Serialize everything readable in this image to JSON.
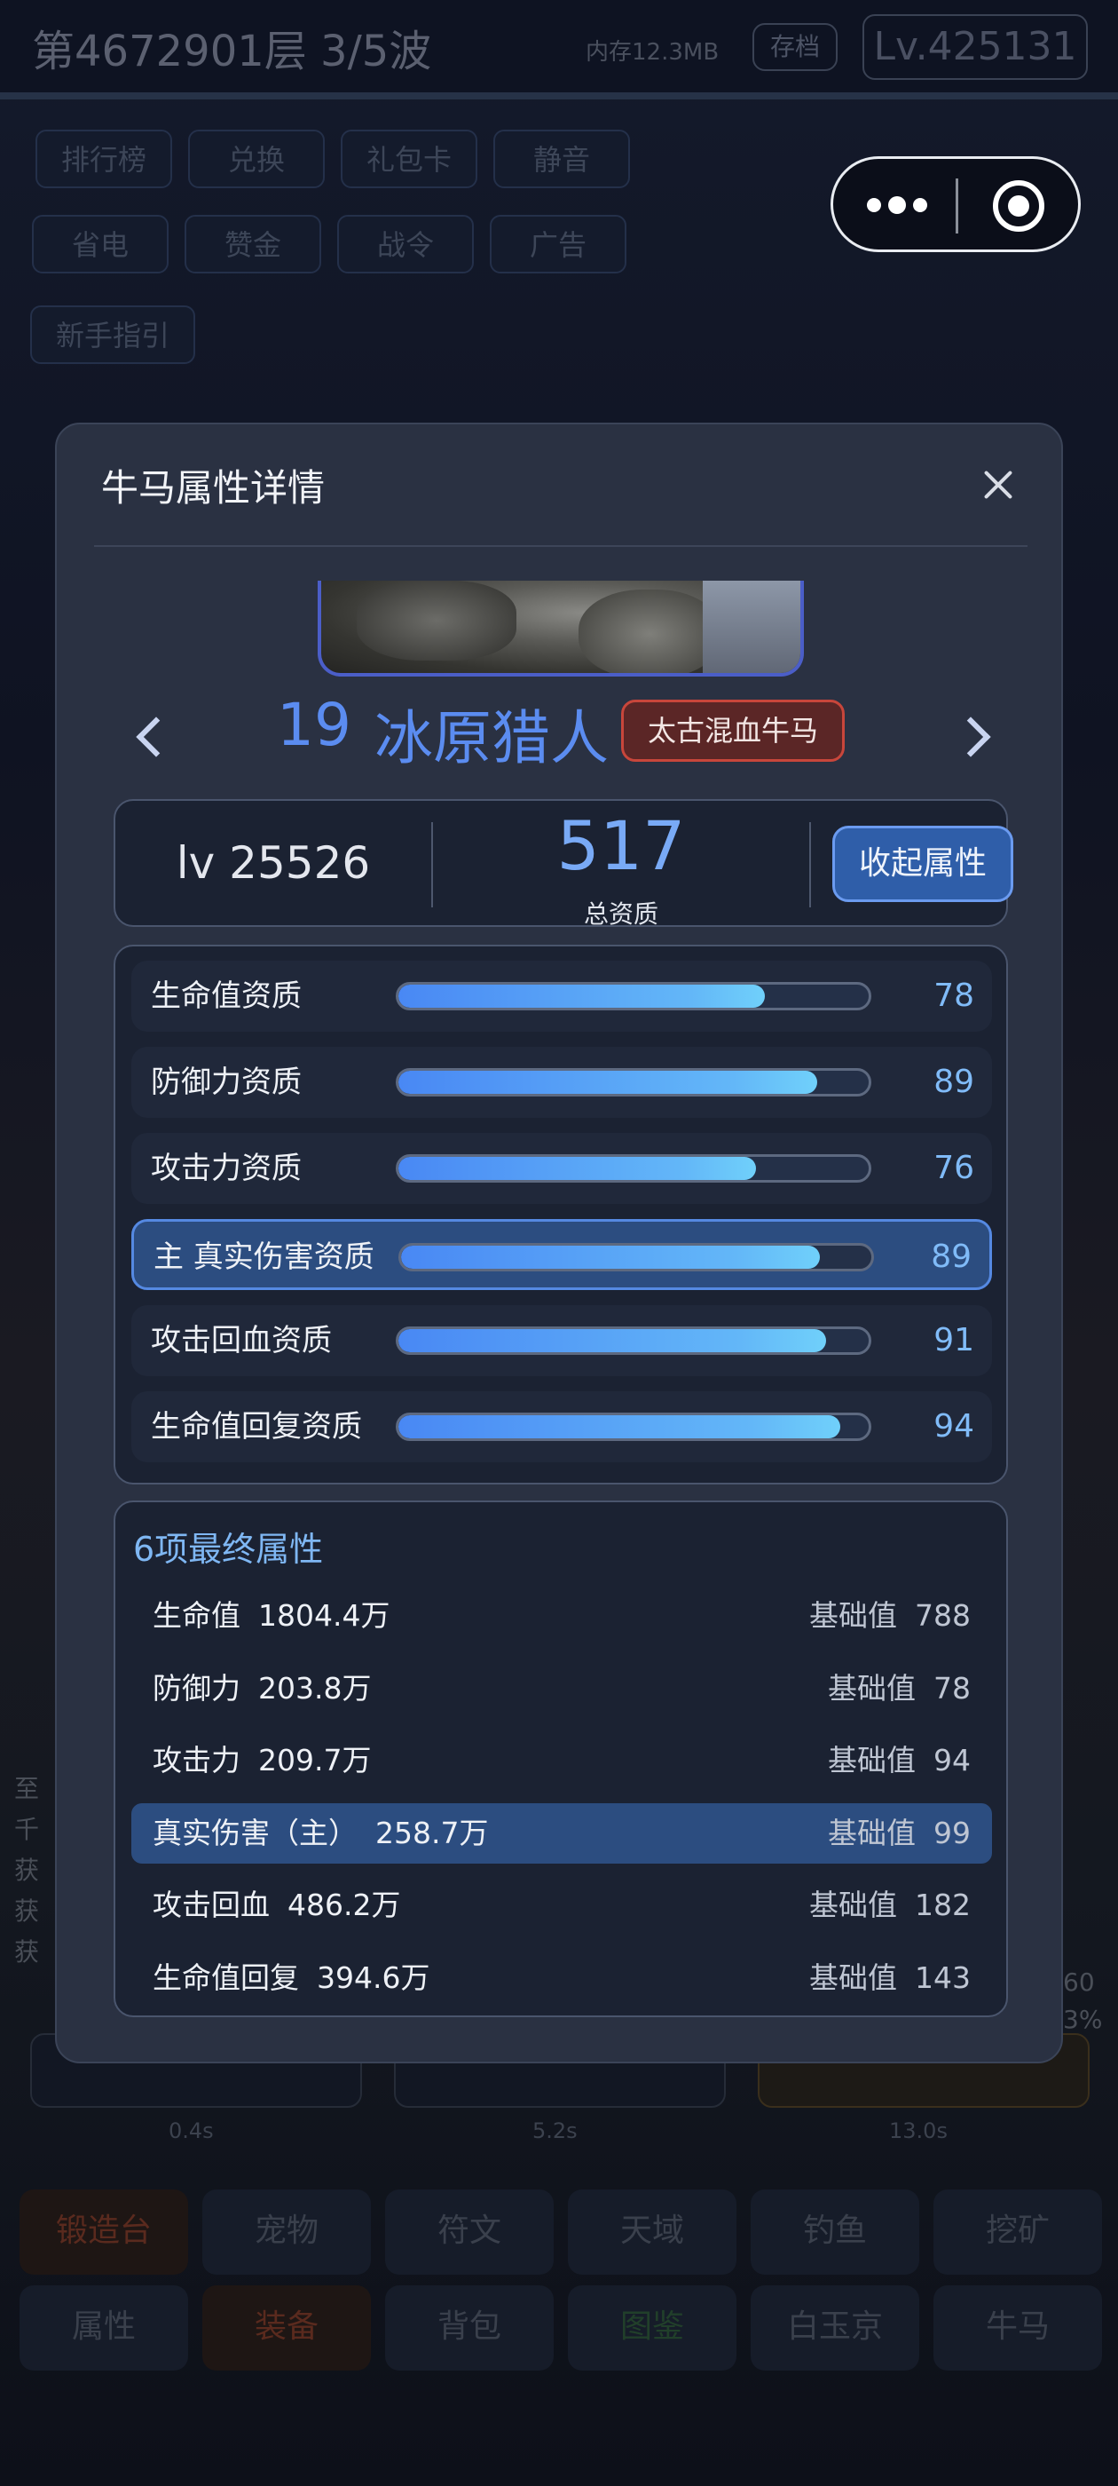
{
  "background": {
    "floor_text": "第4672901层  3/5波",
    "memory_text": "内存12.3MB",
    "save_label": "存档",
    "level_text": "Lv.425131",
    "buttons_row1": [
      "排行榜",
      "兑换",
      "礼包卡",
      "静音"
    ],
    "buttons_row2": [
      "省电",
      "赞金",
      "战令",
      "广告"
    ],
    "guide_button": "新手指引",
    "side_text": [
      "至",
      "千",
      "获",
      "获",
      "获"
    ],
    "side_right_text": [
      "60",
      "3%"
    ],
    "stat_labels": [
      "0.4s",
      "5.2s",
      "13.0s"
    ],
    "footer_row1": [
      "锻造台",
      "宠物",
      "符文",
      "天域",
      "钓鱼",
      "挖矿"
    ],
    "footer_row2": [
      "属性",
      "装备",
      "背包",
      "图鉴",
      "白玉京",
      "牛马"
    ]
  },
  "capsule": {
    "more_icon": "more-dots-icon",
    "close_icon": "target-circle-icon"
  },
  "modal": {
    "title": "牛马属性详情",
    "hero": {
      "id": "19",
      "name": "冰原猎人",
      "badge": "太古混血牛马",
      "badge_color": "#c8463b"
    },
    "summary": {
      "level": "lv 25526",
      "total_value": "517",
      "total_label": "总资质",
      "collapse_button": "收起属性"
    },
    "aptitudes": [
      {
        "label": "生命值资质",
        "value": "78",
        "fraction": 0.78,
        "highlight": false
      },
      {
        "label": "防御力资质",
        "value": "89",
        "fraction": 0.89,
        "highlight": false
      },
      {
        "label": "攻击力资质",
        "value": "76",
        "fraction": 0.76,
        "highlight": false
      },
      {
        "label": "主 真实伤害资质",
        "value": "89",
        "fraction": 0.89,
        "highlight": true
      },
      {
        "label": "攻击回血资质",
        "value": "91",
        "fraction": 0.91,
        "highlight": false
      },
      {
        "label": "生命值回复资质",
        "value": "94",
        "fraction": 0.94,
        "highlight": false
      }
    ],
    "final_title": "6项最终属性",
    "final_attributes": [
      {
        "name": "生命值",
        "value": "1804.4万",
        "base_label": "基础值",
        "base": "788",
        "highlight": false
      },
      {
        "name": "防御力",
        "value": "203.8万",
        "base_label": "基础值",
        "base": "78",
        "highlight": false
      },
      {
        "name": "攻击力",
        "value": "209.7万",
        "base_label": "基础值",
        "base": "94",
        "highlight": false
      },
      {
        "name": "真实伤害（主）",
        "value": "258.7万",
        "base_label": "基础值",
        "base": "99",
        "highlight": true
      },
      {
        "name": "攻击回血",
        "value": "486.2万",
        "base_label": "基础值",
        "base": "182",
        "highlight": false
      },
      {
        "name": "生命值回复",
        "value": "394.6万",
        "base_label": "基础值",
        "base": "143",
        "highlight": false
      }
    ]
  },
  "colors": {
    "accent": "#5b8cf0",
    "panel": "#2a3142",
    "highlight": "#2c4d80"
  }
}
